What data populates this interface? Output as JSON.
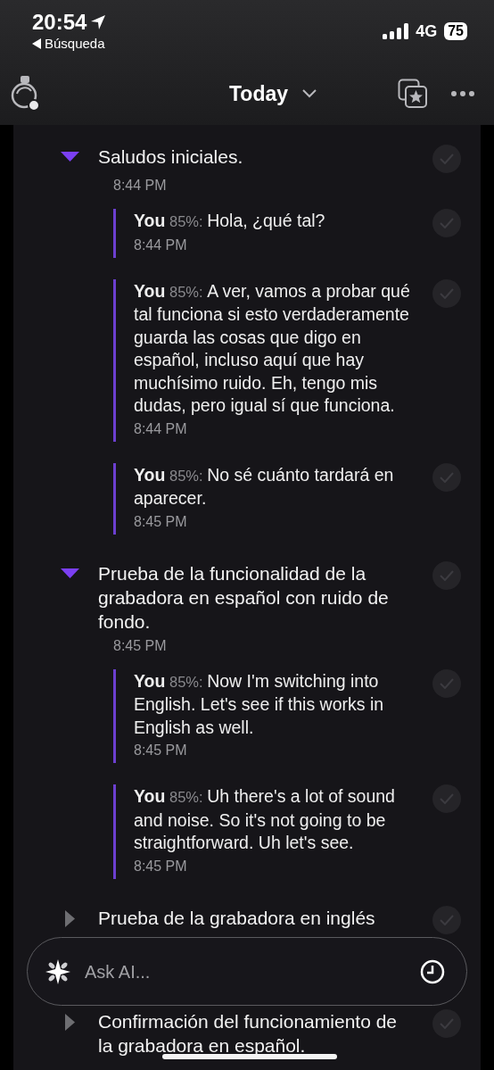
{
  "status_bar": {
    "time": "20:54",
    "back_label": "Búsqueda",
    "network": "4G",
    "battery": "75"
  },
  "header": {
    "title": "Today"
  },
  "sections": [
    {
      "title": "Saludos iniciales.",
      "time": "8:44 PM",
      "expanded": true,
      "checked": false,
      "items": [
        {
          "speaker": "You",
          "confidence": "85%:",
          "text": "Hola, ¿qué tal?",
          "time": "8:44 PM",
          "checked": false
        },
        {
          "speaker": "You",
          "confidence": "85%:",
          "text": "A ver, vamos a probar qué tal funciona si esto verdaderamente guarda las cosas que digo en español, incluso aquí que hay muchísimo ruido. Eh, tengo mis dudas, pero igual sí que funciona.",
          "time": "8:44 PM",
          "checked": false
        },
        {
          "speaker": "You",
          "confidence": "85%:",
          "text": "No sé cuánto tardará en aparecer.",
          "time": "8:45 PM",
          "checked": false
        }
      ]
    },
    {
      "title": "Prueba de la funcionalidad de la grabadora en español con ruido de fondo.",
      "time": "8:45 PM",
      "expanded": true,
      "checked": false,
      "items": [
        {
          "speaker": "You",
          "confidence": "85%:",
          "text": "Now I'm switching into English. Let's see if this works in English as well.",
          "time": "8:45 PM",
          "checked": false
        },
        {
          "speaker": "You",
          "confidence": "85%:",
          "text": "Uh there's a lot of sound and noise. So it's not going to be straightforward. Uh let's see.",
          "time": "8:45 PM",
          "checked": false
        }
      ]
    },
    {
      "title": "Prueba de la grabadora en inglés",
      "expanded": false,
      "checked": false
    },
    {
      "title": "Confirmación del funcionamiento de la grabadora en español.",
      "expanded": false,
      "checked": false
    }
  ],
  "ask_bar": {
    "placeholder": "Ask AI..."
  }
}
